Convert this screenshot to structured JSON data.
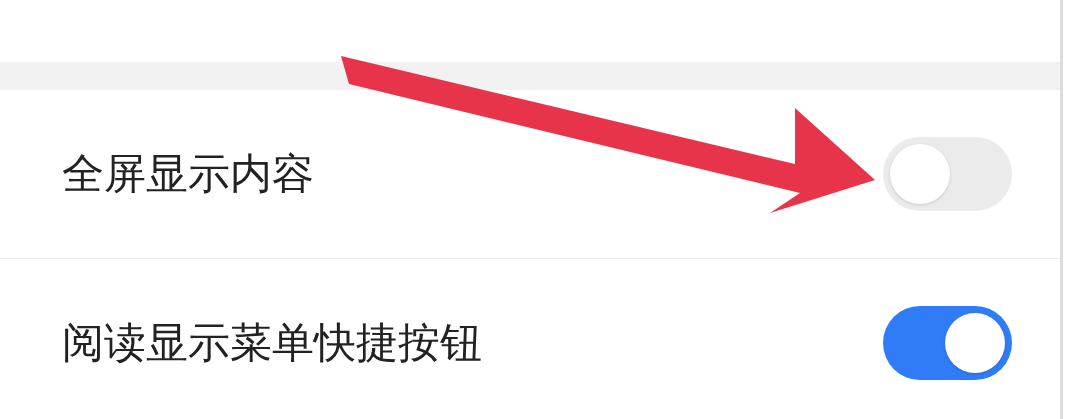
{
  "settings": [
    {
      "label": "全屏显示内容",
      "on": false
    },
    {
      "label": "阅读显示菜单快捷按钮",
      "on": true
    }
  ]
}
